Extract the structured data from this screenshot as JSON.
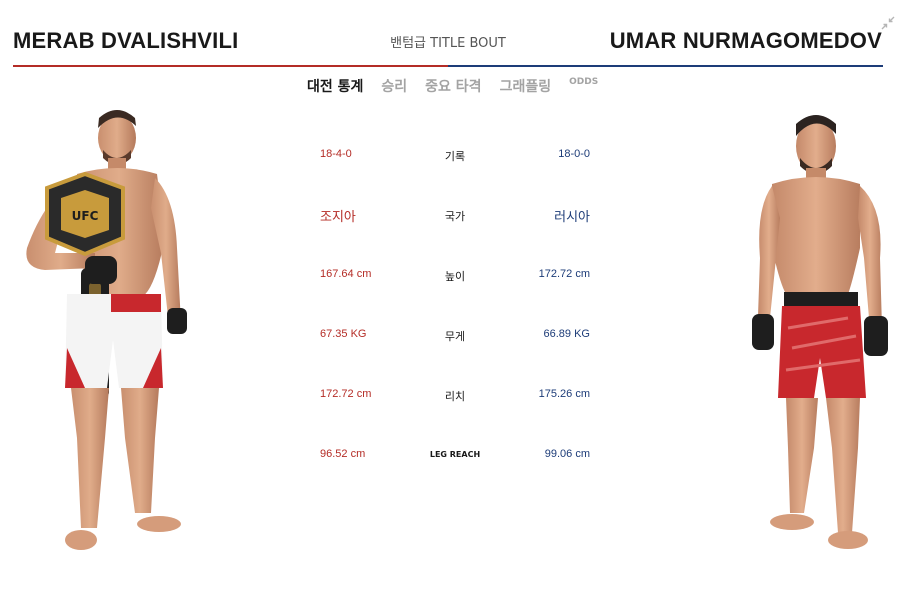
{
  "header": {
    "fighter_left_name": "MERAB DVALISHVILI",
    "fighter_right_name": "UMAR NURMAGOMEDOV",
    "bout_label": "밴텀급 TITLE BOUT"
  },
  "tabs": [
    {
      "label": "대전 통계",
      "active": true
    },
    {
      "label": "승리",
      "active": false
    },
    {
      "label": "중요 타격",
      "active": false
    },
    {
      "label": "그래플링",
      "active": false
    },
    {
      "label": "ODDS",
      "active": false
    }
  ],
  "stats": [
    {
      "label": "기록",
      "left": "18-4-0",
      "right": "18-0-0"
    },
    {
      "label": "국가",
      "left": "조지아",
      "right": "러시아"
    },
    {
      "label": "높이",
      "left": "167.64 cm",
      "right": "172.72 cm"
    },
    {
      "label": "무게",
      "left": "67.35 KG",
      "right": "66.89 KG"
    },
    {
      "label": "리치",
      "left": "172.72 cm",
      "right": "175.26 cm"
    },
    {
      "label": "LEG REACH",
      "left": "96.52 cm",
      "right": "99.06 cm"
    }
  ],
  "colors": {
    "left_accent": "#b42c26",
    "right_accent": "#1d3c78",
    "belt_gold": "#c89b3c",
    "shorts_red": "#c8282d"
  },
  "icons": {
    "collapse": "collapse-arrows-icon"
  }
}
